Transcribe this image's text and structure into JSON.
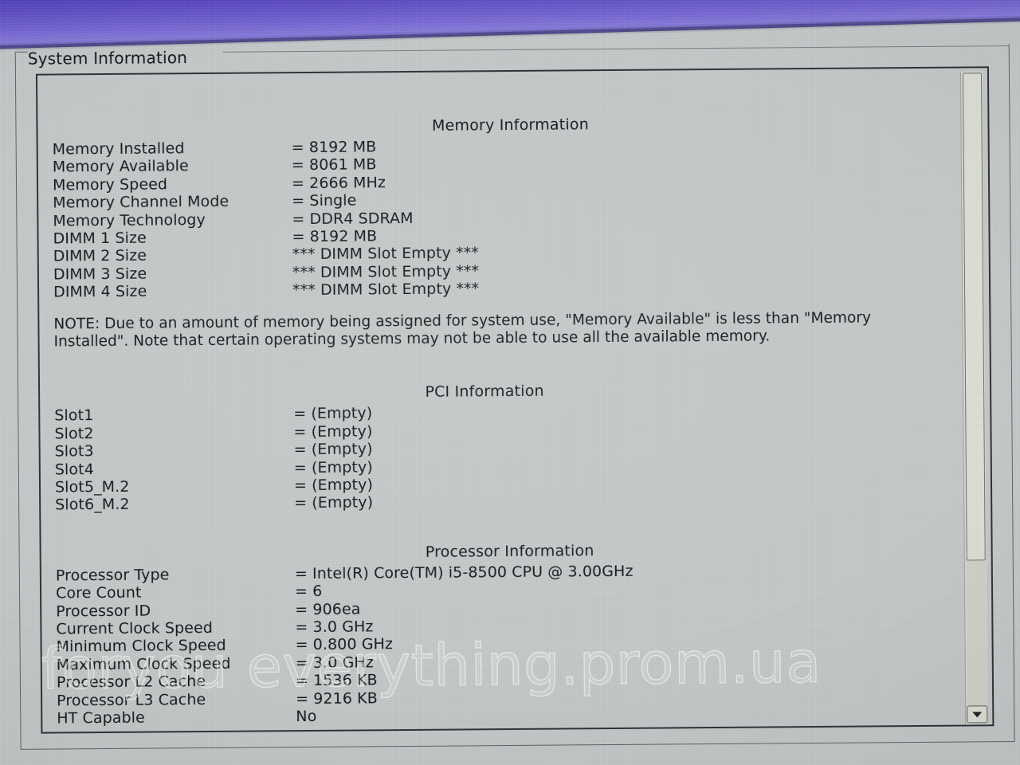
{
  "window": {
    "group_title": "System Information"
  },
  "sections": [
    {
      "id": "memory",
      "title": "Memory Information",
      "rows": [
        {
          "key": "Memory Installed",
          "value": "= 8192 MB"
        },
        {
          "key": "Memory Available",
          "value": "= 8061 MB"
        },
        {
          "key": "Memory Speed",
          "value": "= 2666 MHz"
        },
        {
          "key": "Memory Channel Mode",
          "value": "= Single"
        },
        {
          "key": "Memory Technology",
          "value": "= DDR4 SDRAM"
        },
        {
          "key": "DIMM 1 Size",
          "value": "= 8192 MB"
        },
        {
          "key": "DIMM 2 Size",
          "value": "*** DIMM Slot Empty ***"
        },
        {
          "key": "DIMM 3 Size",
          "value": "*** DIMM Slot Empty ***"
        },
        {
          "key": "DIMM 4 Size",
          "value": "*** DIMM Slot Empty ***"
        }
      ],
      "note": "NOTE: Due to an amount of memory being assigned for system use, \"Memory Available\" is less than \"Memory Installed\". Note that certain operating systems may not be able to use all the available memory."
    },
    {
      "id": "pci",
      "title": "PCI Information",
      "rows": [
        {
          "key": "Slot1",
          "value": "= (Empty)"
        },
        {
          "key": "Slot2",
          "value": "= (Empty)"
        },
        {
          "key": "Slot3",
          "value": "= (Empty)"
        },
        {
          "key": "Slot4",
          "value": "= (Empty)"
        },
        {
          "key": "Slot5_M.2",
          "value": "= (Empty)"
        },
        {
          "key": "Slot6_M.2",
          "value": "= (Empty)"
        }
      ]
    },
    {
      "id": "cpu",
      "title": "Processor Information",
      "rows": [
        {
          "key": "Processor Type",
          "value": "= Intel(R) Core(TM) i5-8500 CPU @ 3.00GHz"
        },
        {
          "key": "Core Count",
          "value": "= 6"
        },
        {
          "key": "Processor ID",
          "value": "= 906ea"
        },
        {
          "key": "Current Clock Speed",
          "value": "= 3.0 GHz"
        },
        {
          "key": "Minimum Clock Speed",
          "value": "= 0.800 GHz"
        },
        {
          "key": "Maximum Clock Speed",
          "value": "= 3.0 GHz"
        },
        {
          "key": "Processor L2 Cache",
          "value": "= 1536 KB"
        },
        {
          "key": "Processor L3 Cache",
          "value": "= 9216 KB"
        },
        {
          "key": "HT Capable",
          "value": "No"
        }
      ]
    }
  ],
  "scrollbar": {
    "down_arrow_glyph": "▼"
  },
  "watermark": {
    "text": "foryou everything.prom.ua"
  },
  "colors": {
    "screen_background": "#c3c7c7",
    "top_band": "#5d4cc3",
    "text": "#141619",
    "frame_border": "#2d3033",
    "scrollbar_face": "#dcddd4"
  }
}
